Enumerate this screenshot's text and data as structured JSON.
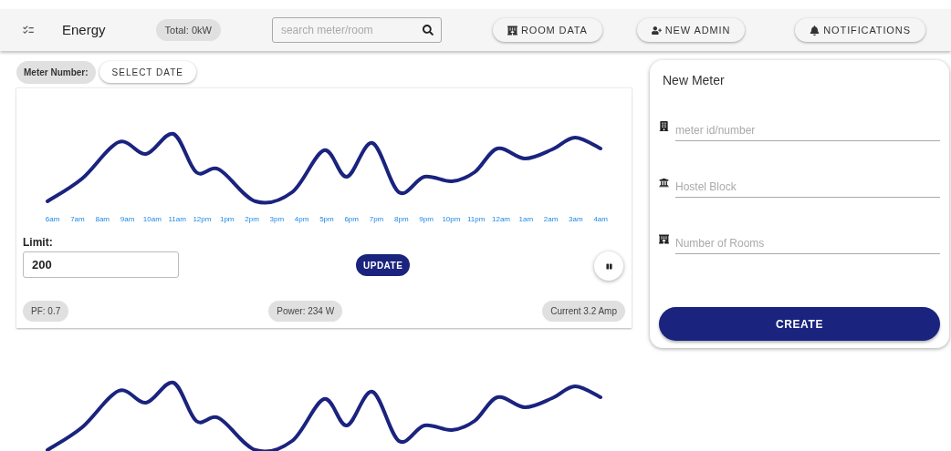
{
  "header": {
    "title": "Energy",
    "total": "Total: 0kW",
    "search": {
      "placeholder": "search meter/room"
    },
    "buttons": [
      {
        "label": "ROOM DATA",
        "kind": "rooms"
      },
      {
        "label": "NEW ADMIN",
        "kind": "admin"
      },
      {
        "label": "NOTIFICATIONS",
        "kind": "bell"
      }
    ]
  },
  "meter_panel": {
    "meter_number": "Meter Number:",
    "select_date": "SELECT DATE",
    "time_labels": [
      "6am",
      "7am",
      "8am",
      "9am",
      "10am",
      "11am",
      "12pm",
      "1pm",
      "2pm",
      "3pm",
      "4pm",
      "5pm",
      "6pm",
      "7pm",
      "8pm",
      "9pm",
      "10pm",
      "11pm",
      "12am",
      "1am",
      "2am",
      "3am",
      "4am"
    ],
    "limit": {
      "label": "Limit:",
      "value": "200"
    },
    "update": "UPDATE",
    "readings": [
      "PF: 0.7",
      "Power: 234 W",
      "Current 3.2 Amp"
    ]
  },
  "new_meter": {
    "title": "New Meter",
    "fields": [
      {
        "placeholder": "meter id/number",
        "kind": "building"
      },
      {
        "placeholder": "Hostel Block",
        "kind": "bank"
      },
      {
        "placeholder": "Number of Rooms",
        "kind": "hotel"
      }
    ],
    "create": "CREATE"
  }
}
